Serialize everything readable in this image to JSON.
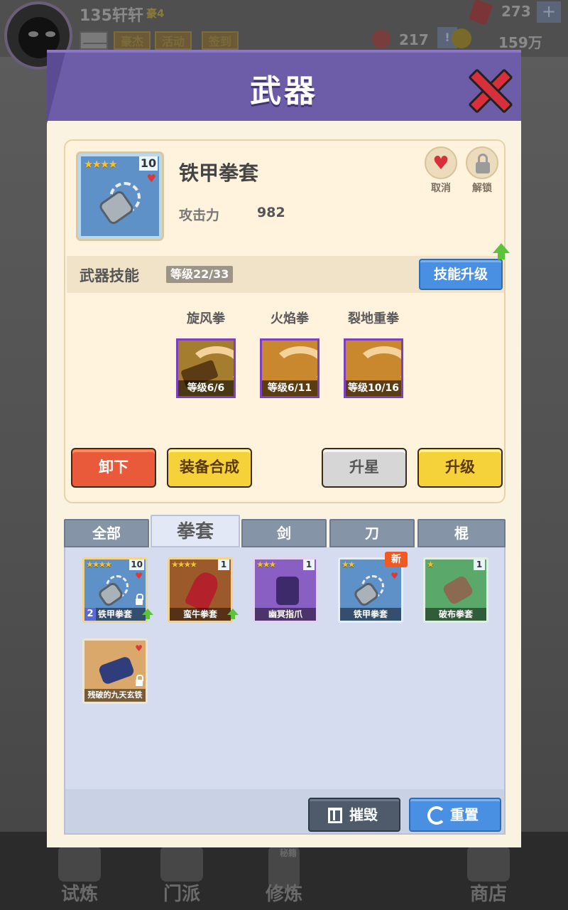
{
  "background": {
    "player_name": "135轩轩",
    "player_rank": "豪4",
    "tags": [
      "豪杰",
      "活动",
      "签到"
    ],
    "gems": "273",
    "plus": "+",
    "tickets": "217",
    "alert": "!",
    "coins": "159万",
    "nav": [
      "试炼",
      "门派",
      "修炼",
      "",
      "商店"
    ],
    "book_label": "秘籍"
  },
  "modal": {
    "title": "武器",
    "item": {
      "name": "铁甲拳套",
      "stars": "★★★★",
      "level": "10",
      "attack_label": "攻击力",
      "attack_value": "982"
    },
    "favorite_label": "取消",
    "unlock_label": "解锁",
    "skills": {
      "title": "武器技能",
      "level_tag": "等级22/33",
      "upgrade_label": "技能升级",
      "list": [
        {
          "name": "旋风拳",
          "level": "等级6/6"
        },
        {
          "name": "火焰拳",
          "level": "等级6/11"
        },
        {
          "name": "裂地重拳",
          "level": "等级10/16"
        }
      ]
    },
    "actions": {
      "unequip": "卸下",
      "synthesize": "装备合成",
      "star_up": "升星",
      "upgrade": "升级"
    },
    "tabs": [
      "全部",
      "拳套",
      "剑",
      "刀",
      "棍"
    ],
    "active_tab": "拳套",
    "inventory": [
      {
        "name": "铁甲拳套",
        "stars": "★★★★",
        "level": "10",
        "count": "2"
      },
      {
        "name": "蛮牛拳套",
        "stars": "★★★★",
        "level": "1"
      },
      {
        "name": "幽冥指爪",
        "stars": "★★★",
        "level": "1"
      },
      {
        "name": "铁甲拳套",
        "stars": "★★",
        "badge": "新"
      },
      {
        "name": "破布拳套",
        "stars": "★",
        "level": "1"
      },
      {
        "name": "残破的九天玄铁"
      }
    ],
    "destroy_label": "摧毁",
    "reset_label": "重置"
  },
  "colors": {
    "header": "#6d5ca8",
    "blue_button": "#4a90e2",
    "red_button": "#e85a3a",
    "yellow_button": "#f6d23a",
    "star": "#f2c23a"
  }
}
